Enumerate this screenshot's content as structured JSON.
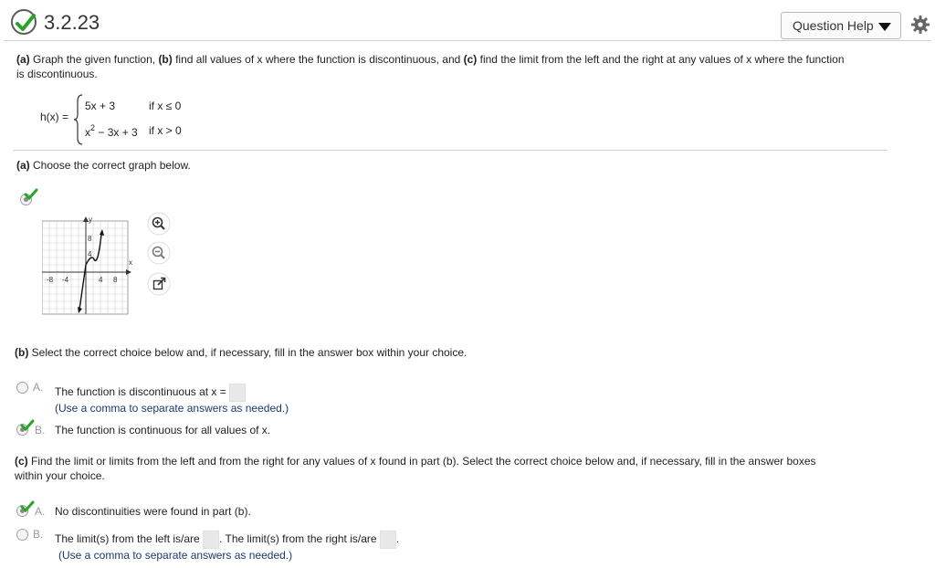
{
  "header": {
    "question_number": "3.2.23",
    "help_label": "Question Help"
  },
  "prompt": {
    "part_a_tag": "(a)",
    "text_1": " Graph the given function, ",
    "part_b_tag": "(b)",
    "text_2": " find all values of x where the function is discontinuous, and ",
    "part_c_tag": "(c)",
    "text_3": " find the limit from the left and the right at any values of x where the function",
    "text_4": "is discontinuous."
  },
  "function": {
    "label": "h(x) =",
    "case1_expr": "5x + 3",
    "case1_cond": "if x ≤ 0",
    "case2_expr_base": "x",
    "case2_expr_exp": "2",
    "case2_expr_rest": " − 3x + 3",
    "case2_cond": "if x > 0"
  },
  "part_a": {
    "tag": "(a)",
    "instruction": " Choose the correct graph below."
  },
  "graph": {
    "y_label": "y",
    "x_label": "x",
    "y_tick_8": "8",
    "y_tick_4": "4",
    "x_tick_neg8": "-8",
    "x_tick_neg4": "-4",
    "x_tick_4": "4",
    "x_tick_8": "8"
  },
  "part_b": {
    "tag": "(b)",
    "instruction": " Select the correct choice below and, if necessary, fill in the answer box within your choice.",
    "option_a_letter": "A.",
    "option_a_text": "The function is discontinuous at x =",
    "option_a_hint": "(Use a comma to separate answers as needed.)",
    "option_b_letter": "B.",
    "option_b_text": "The function is continuous for all values of x."
  },
  "part_c": {
    "tag": "(c)",
    "instruction_1": " Find the limit or limits from the left and from the right for any values of x found in part (b). Select the correct choice below and, if necessary, fill in the answer boxes",
    "instruction_2": "within your choice.",
    "option_a_letter": "A.",
    "option_a_text": "No discontinuities were found in part (b).",
    "option_b_letter": "B.",
    "option_b_text_1": "The limit(s) from the left is/are",
    "option_b_text_2": ". The limit(s) from the right is/are",
    "option_b_text_3": ".",
    "option_b_hint": "(Use a comma to separate answers as needed.)"
  },
  "colors": {
    "check_green": "#2aa32a",
    "hint_blue": "#1b3a6b"
  }
}
